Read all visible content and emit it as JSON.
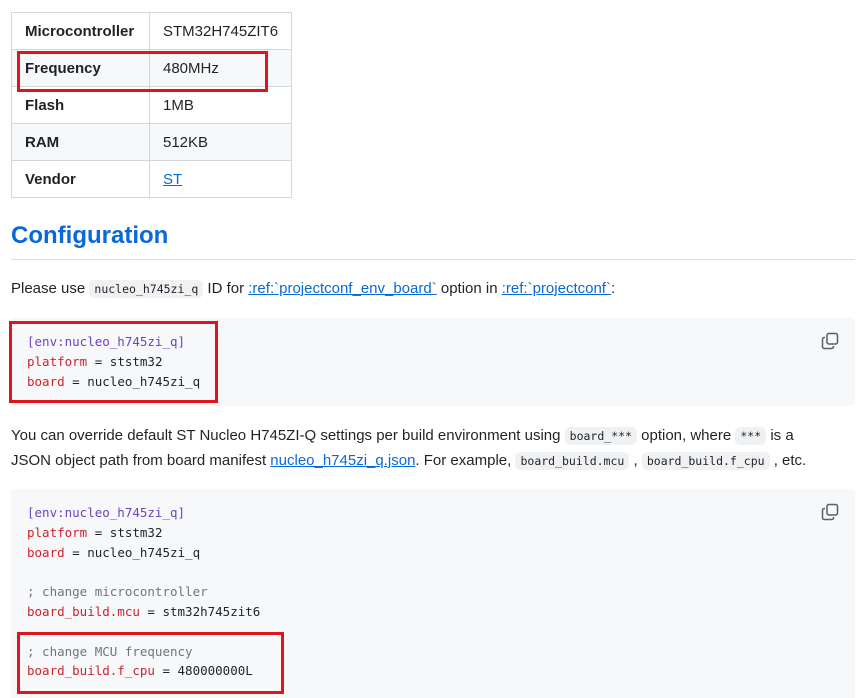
{
  "specs": [
    {
      "key": "Microcontroller",
      "value": "STM32H745ZIT6"
    },
    {
      "key": "Frequency",
      "value": "480MHz"
    },
    {
      "key": "Flash",
      "value": "1MB"
    },
    {
      "key": "RAM",
      "value": "512KB"
    },
    {
      "key": "Vendor",
      "value": "ST"
    }
  ],
  "config": {
    "heading": "Configuration",
    "p1": {
      "t1": "Please use ",
      "code1": "nucleo_h745zi_q",
      "t2": " ID for ",
      "link1": ":ref:`projectconf_env_board`",
      "t3": " option in ",
      "link2": ":ref:`projectconf`",
      "t4": ":"
    },
    "code1": {
      "section": "[env:nucleo_h745zi_q]",
      "platform_key": "platform",
      "platform_val": " = ststm32",
      "board_key": "board",
      "board_val": " = nucleo_h745zi_q"
    },
    "p2": {
      "t1": "You can override default ST Nucleo H745ZI-Q settings per build environment using ",
      "code1": "board_***",
      "t2": " option, where ",
      "code2": "***",
      "t3": " is a",
      "t4": "JSON object path from board manifest ",
      "link": "nucleo_h745zi_q.json",
      "t5": ". For example, ",
      "code3": "board_build.mcu",
      "t6": " , ",
      "code4": "board_build.f_cpu",
      "t7": " , etc."
    },
    "code2": {
      "section": "[env:nucleo_h745zi_q]",
      "platform_key": "platform",
      "platform_val": " = ststm32",
      "board_key": "board",
      "board_val": " = nucleo_h745zi_q",
      "comment1": "; change microcontroller",
      "mcu_key": "board_build.mcu",
      "mcu_val": " = stm32h745zit6",
      "comment2": "; change MCU frequency",
      "fcpu_key": "board_build.f_cpu",
      "fcpu_val": " = 480000000L"
    }
  },
  "icons": {
    "copy": "copy-icon"
  },
  "colors": {
    "link": "#0969da",
    "highlight": "#e0141e",
    "code_bg": "#f6f8fa"
  }
}
